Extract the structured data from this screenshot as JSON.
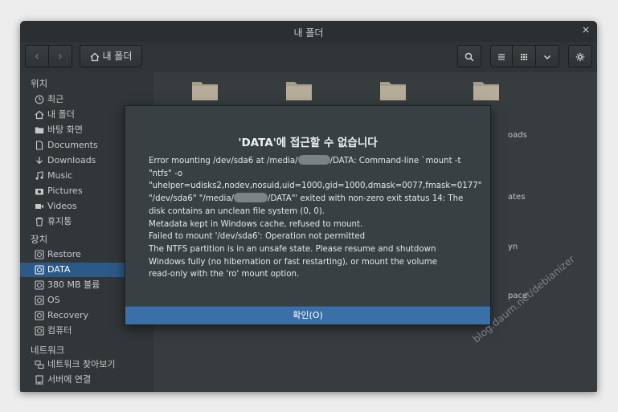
{
  "window": {
    "title": "내 폴더",
    "close": "×"
  },
  "toolbar": {
    "back": "‹",
    "forward": "›",
    "location_label": "내 폴더"
  },
  "sidebar": {
    "sections": [
      {
        "heading": "위치"
      },
      {
        "heading": "장치"
      },
      {
        "heading": "네트워크"
      }
    ],
    "places": [
      {
        "label": "최근",
        "icon": "clock-icon"
      },
      {
        "label": "내 폴더",
        "icon": "home-icon"
      },
      {
        "label": "바탕 화면",
        "icon": "folder-icon"
      },
      {
        "label": "Documents",
        "icon": "document-icon"
      },
      {
        "label": "Downloads",
        "icon": "download-icon"
      },
      {
        "label": "Music",
        "icon": "music-icon"
      },
      {
        "label": "Pictures",
        "icon": "camera-icon"
      },
      {
        "label": "Videos",
        "icon": "video-icon"
      },
      {
        "label": "휴지통",
        "icon": "trash-icon"
      }
    ],
    "devices": [
      {
        "label": "Restore",
        "icon": "drive-icon"
      },
      {
        "label": "DATA",
        "icon": "drive-icon",
        "selected": true
      },
      {
        "label": "380 MB 볼륨",
        "icon": "drive-icon"
      },
      {
        "label": "OS",
        "icon": "drive-icon"
      },
      {
        "label": "Recovery",
        "icon": "drive-icon"
      },
      {
        "label": "컴퓨터",
        "icon": "drive-icon"
      }
    ],
    "network": [
      {
        "label": "네트워크 찾아보기",
        "icon": "network-icon"
      },
      {
        "label": "서버에 연결",
        "icon": "server-icon"
      }
    ]
  },
  "content": {
    "fragments": [
      "oads",
      "ates",
      "yn",
      "pace"
    ]
  },
  "dialog": {
    "title": "'DATA'에 접근할 수 없습니다",
    "lines": {
      "l1a": "Error mounting /dev/sda6 at /media/",
      "l1b": "/DATA: Command-line `mount -t",
      "l2": "\"ntfs\" -o",
      "l3": "\"uhelper=udisks2,nodev,nosuid,uid=1000,gid=1000,dmask=0077,fmask=0177\"",
      "l4a": "\"/dev/sda6\" \"/media/",
      "l4b": "/DATA\"' exited with non-zero exit status 14: The",
      "l5": "disk contains an unclean file system (0, 0).",
      "l6": "Metadata kept in Windows cache, refused to mount.",
      "l7": "Failed to mount '/dev/sda6': Operation not permitted",
      "l8": "The NTFS partition is in an unsafe state. Please resume and shutdown",
      "l9": "Windows fully (no hibernation or fast restarting), or mount the volume",
      "l10": "read-only with the 'ro' mount option."
    },
    "ok_label": "확인(O)"
  },
  "watermark": "blog.daum.net/debianizer",
  "colors": {
    "window_bg": "#2f3436",
    "selection": "#2c5a86",
    "dialog_button": "#3a6fa7",
    "folder": "#a59c8a"
  }
}
